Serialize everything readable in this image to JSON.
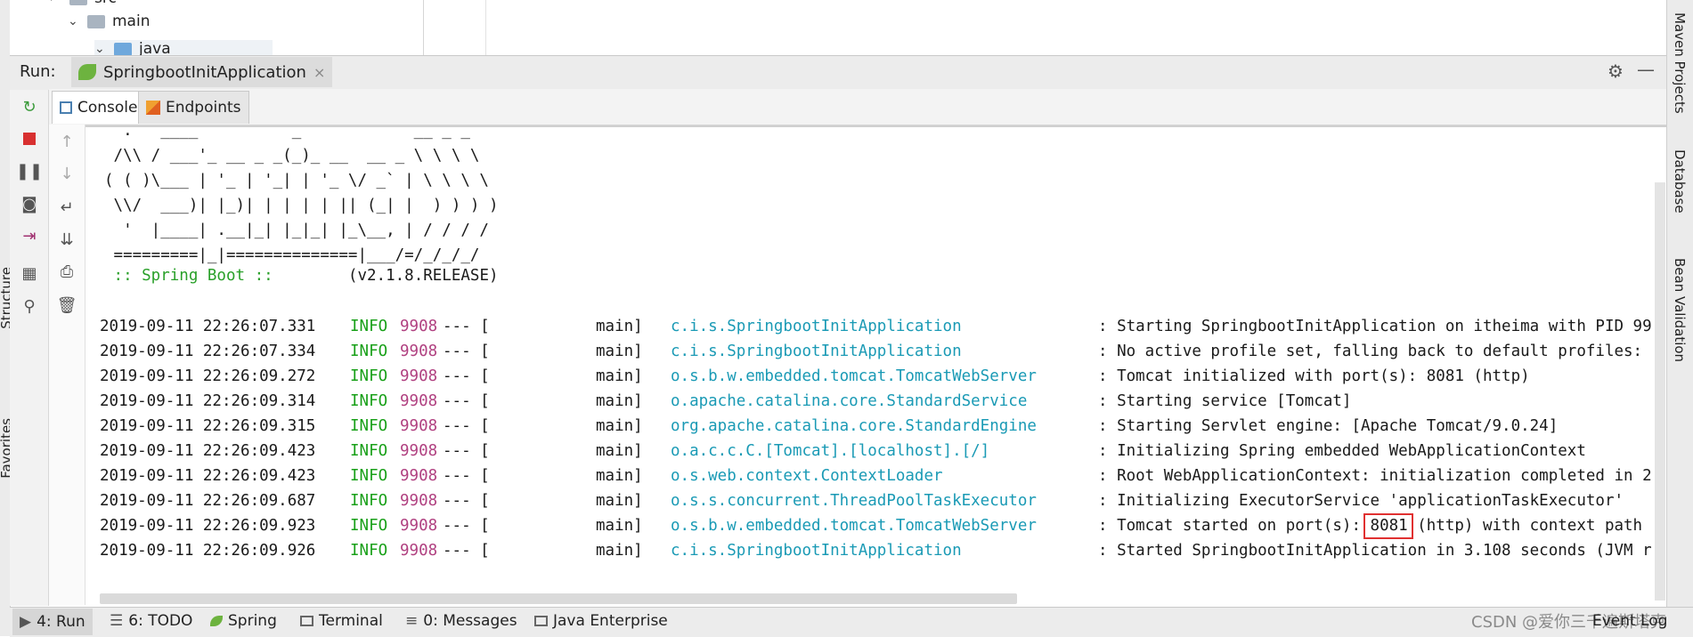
{
  "project_tree": {
    "items": [
      {
        "label": "src",
        "level": 1
      },
      {
        "label": "main",
        "level": 2
      },
      {
        "label": "java",
        "level": 3
      }
    ]
  },
  "run_panel": {
    "label": "Run:",
    "config_tab": "SpringbootInitApplication",
    "close": "×"
  },
  "console_tabs": [
    "Console",
    "Endpoints"
  ],
  "banner": {
    "lines": [
      "  .   ____          _            __ _ _",
      " /\\\\ / ___'_ __ _ _(_)_ __  __ _ \\ \\ \\ \\",
      "( ( )\\___ | '_ | '_| | '_ \\/ _` | \\ \\ \\ \\",
      " \\\\/  ___)| |_)| | | | | || (_| |  ) ) ) )",
      "  '  |____| .__|_| |_|_| |_\\__, | / / / /",
      " =========|_|==============|___/=/_/_/_/"
    ],
    "spring_label": " :: Spring Boot :: ",
    "version": "       (v2.1.8.RELEASE)"
  },
  "log_rows": [
    {
      "time": "2019-09-11 22:26:07.331",
      "level": "INFO",
      "pid": "9908",
      "sep": "--- [",
      "thread": "main]",
      "logger": "c.i.s.SpringbootInitApplication",
      "msg": ": Starting SpringbootInitApplication on itheima with PID 99"
    },
    {
      "time": "2019-09-11 22:26:07.334",
      "level": "INFO",
      "pid": "9908",
      "sep": "--- [",
      "thread": "main]",
      "logger": "c.i.s.SpringbootInitApplication",
      "msg": ": No active profile set, falling back to default profiles:"
    },
    {
      "time": "2019-09-11 22:26:09.272",
      "level": "INFO",
      "pid": "9908",
      "sep": "--- [",
      "thread": "main]",
      "logger": "o.s.b.w.embedded.tomcat.TomcatWebServer",
      "msg": ": Tomcat initialized with port(s): 8081 (http)"
    },
    {
      "time": "2019-09-11 22:26:09.314",
      "level": "INFO",
      "pid": "9908",
      "sep": "--- [",
      "thread": "main]",
      "logger": "o.apache.catalina.core.StandardService",
      "msg": ": Starting service [Tomcat]"
    },
    {
      "time": "2019-09-11 22:26:09.315",
      "level": "INFO",
      "pid": "9908",
      "sep": "--- [",
      "thread": "main]",
      "logger": "org.apache.catalina.core.StandardEngine",
      "msg": ": Starting Servlet engine: [Apache Tomcat/9.0.24]"
    },
    {
      "time": "2019-09-11 22:26:09.423",
      "level": "INFO",
      "pid": "9908",
      "sep": "--- [",
      "thread": "main]",
      "logger": "o.a.c.c.C.[Tomcat].[localhost].[/]",
      "msg": ": Initializing Spring embedded WebApplicationContext"
    },
    {
      "time": "2019-09-11 22:26:09.423",
      "level": "INFO",
      "pid": "9908",
      "sep": "--- [",
      "thread": "main]",
      "logger": "o.s.web.context.ContextLoader",
      "msg": ": Root WebApplicationContext: initialization completed in 2"
    },
    {
      "time": "2019-09-11 22:26:09.687",
      "level": "INFO",
      "pid": "9908",
      "sep": "--- [",
      "thread": "main]",
      "logger": "o.s.s.concurrent.ThreadPoolTaskExecutor",
      "msg": ": Initializing ExecutorService 'applicationTaskExecutor'"
    },
    {
      "time": "2019-09-11 22:26:09.923",
      "level": "INFO",
      "pid": "9908",
      "sep": "--- [",
      "thread": "main]",
      "logger": "o.s.b.w.embedded.tomcat.TomcatWebServer",
      "msg": ": Tomcat started on port(s): 8081 (http) with context path"
    },
    {
      "time": "2019-09-11 22:26:09.926",
      "level": "INFO",
      "pid": "9908",
      "sep": "--- [",
      "thread": "main]",
      "logger": "c.i.s.SpringbootInitApplication",
      "msg": ": Started SpringbootInitApplication in 3.108 seconds (JVM r"
    }
  ],
  "right_tools": [
    "Maven Projects",
    "Database",
    "Bean Validation"
  ],
  "left_tools": [
    "Structure",
    "Favorites"
  ],
  "status_bar": {
    "items": [
      "4: Run",
      "6: TODO",
      "Spring",
      "Terminal",
      "0: Messages",
      "Java Enterprise"
    ],
    "event_log": "Event Log"
  },
  "watermark": "CSDN @爱你三千遍斯塔克",
  "colors": {
    "info": "#18a018",
    "pid": "#b04080",
    "logger": "#1a9ab5",
    "highlight": "#e03030",
    "spring": "#2aa02a"
  }
}
